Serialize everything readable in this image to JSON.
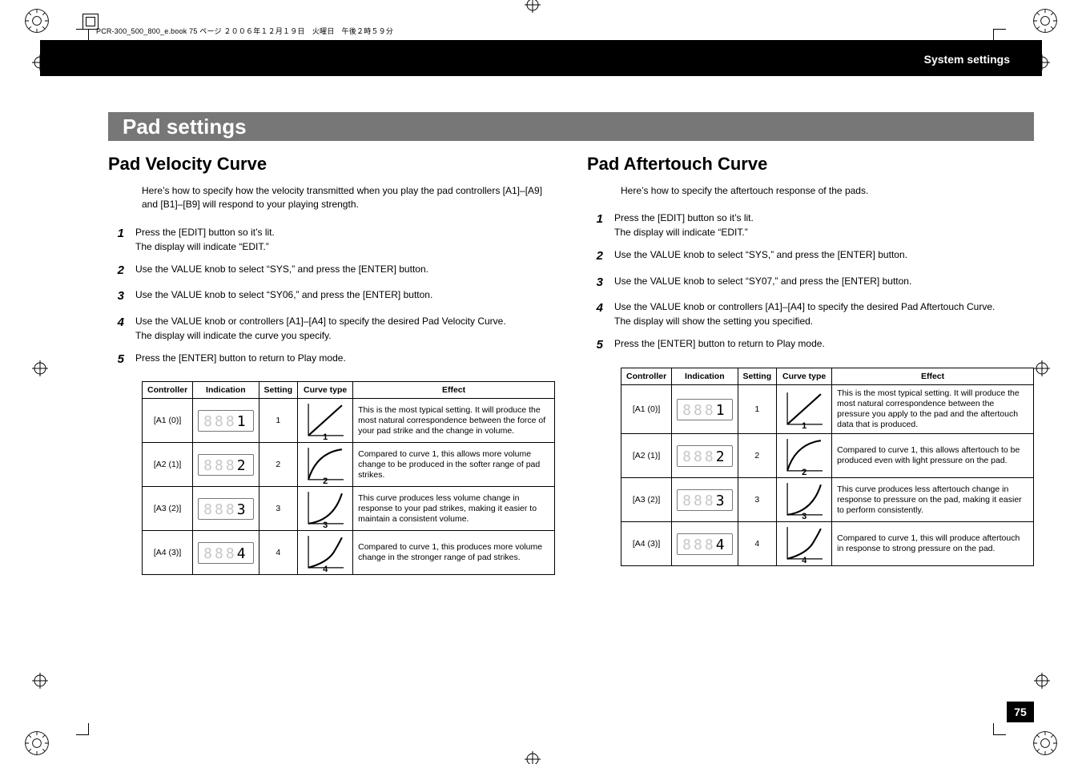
{
  "doc_header": "PCR-300_500_800_e.book 75 ページ ２００６年１２月１９日　火曜日　午後２時５９分",
  "section_title": "System settings",
  "page_title": "Pad settings",
  "page_number": "75",
  "columns": {
    "left": {
      "heading": "Pad Velocity Curve",
      "intro": "Here’s how to specify how the velocity transmitted when you play the pad controllers [A1]–[A9] and [B1]–[B9] will respond to your playing strength.",
      "steps": [
        {
          "n": "1",
          "t": "Press the [EDIT] button so it’s lit.",
          "sub": "The display will indicate “EDIT.”"
        },
        {
          "n": "2",
          "t": "Use the VALUE knob to select “SYS,” and press the [ENTER] button."
        },
        {
          "n": "3",
          "t": "Use the VALUE knob to select “SY06,” and press the [ENTER] button."
        },
        {
          "n": "4",
          "t": "Use the VALUE knob or controllers [A1]–[A4] to specify the desired Pad Velocity Curve.",
          "sub": "The display will indicate the curve you specify."
        },
        {
          "n": "5",
          "t": "Press the [ENTER] button to return to Play mode."
        }
      ],
      "table": {
        "headers": [
          "Controller",
          "Indication",
          "Setting",
          "Curve type",
          "Effect"
        ],
        "rows": [
          {
            "controller": "[A1 (0)]",
            "indication": "1",
            "setting": "1",
            "curve_label": "1",
            "effect": "This is the most typical setting. It will produce the most natural correspondence between the force of your pad strike and the change in volume."
          },
          {
            "controller": "[A2 (1)]",
            "indication": "2",
            "setting": "2",
            "curve_label": "2",
            "effect": "Compared to curve 1, this allows more volume change to be produced in the softer range of pad strikes."
          },
          {
            "controller": "[A3 (2)]",
            "indication": "3",
            "setting": "3",
            "curve_label": "3",
            "effect": "This curve produces less volume change in response to your pad strikes, making it easier to maintain a consistent volume."
          },
          {
            "controller": "[A4 (3)]",
            "indication": "4",
            "setting": "4",
            "curve_label": "4",
            "effect": "Compared to curve 1, this produces more volume change in the stronger range of pad strikes."
          }
        ]
      }
    },
    "right": {
      "heading": "Pad Aftertouch Curve",
      "intro": "Here’s how to specify the aftertouch response of the pads.",
      "steps": [
        {
          "n": "1",
          "t": "Press the [EDIT] button so it’s lit.",
          "sub": "The display will indicate “EDIT.”"
        },
        {
          "n": "2",
          "t": "Use the VALUE knob to select “SYS,” and press the [ENTER] button."
        },
        {
          "n": "3",
          "t": "Use the VALUE knob to select “SY07,” and press the [ENTER] button."
        },
        {
          "n": "4",
          "t": "Use the VALUE knob or controllers [A1]–[A4] to specify the desired Pad Aftertouch Curve.",
          "sub": "The display will show the setting you specified."
        },
        {
          "n": "5",
          "t": "Press the [ENTER] button to return to Play mode."
        }
      ],
      "table": {
        "headers": [
          "Controller",
          "Indication",
          "Setting",
          "Curve type",
          "Effect"
        ],
        "rows": [
          {
            "controller": "[A1 (0)]",
            "indication": "1",
            "setting": "1",
            "curve_label": "1",
            "effect": "This is the most typical setting. It will produce the most natural correspondence between the pressure you apply to the pad and the aftertouch data that is produced."
          },
          {
            "controller": "[A2 (1)]",
            "indication": "2",
            "setting": "2",
            "curve_label": "2",
            "effect": "Compared to curve 1, this allows aftertouch to be produced even with light pressure on the pad."
          },
          {
            "controller": "[A3 (2)]",
            "indication": "3",
            "setting": "3",
            "curve_label": "3",
            "effect": "This curve produces less aftertouch change in response to pressure on the pad, making it easier to perform consistently."
          },
          {
            "controller": "[A4 (3)]",
            "indication": "4",
            "setting": "4",
            "curve_label": "4",
            "effect": "Compared to curve 1, this will produce aftertouch in response to strong pressure on the pad."
          }
        ]
      }
    }
  }
}
